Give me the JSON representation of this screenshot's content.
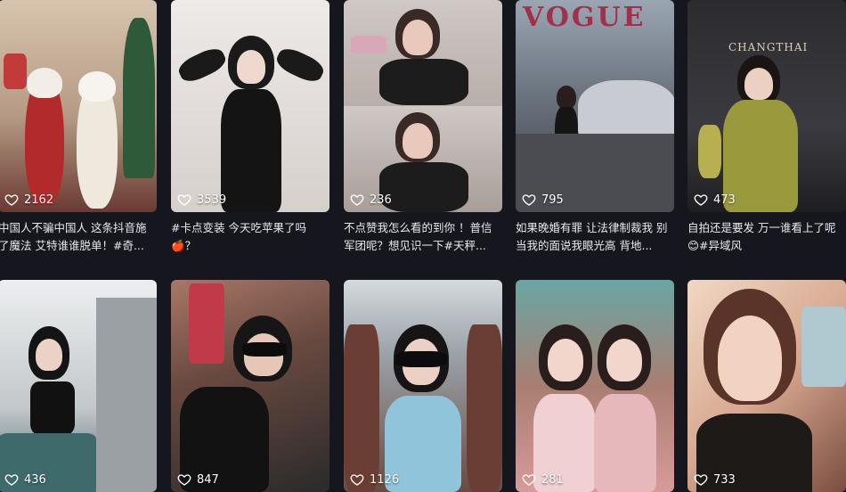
{
  "accent": "#ffffff",
  "background": "#16161e",
  "cards": [
    {
      "likes": "2162",
      "caption": "中国人不骗中国人 这条抖音施了魔法 艾特谁谁脱单！#奇...",
      "bg": [
        "#c9b29a",
        "#7a4a3a"
      ],
      "icon": "heart-icon"
    },
    {
      "likes": "3539",
      "caption": "#卡点变装 今天吃苹果了吗🍎？",
      "bg": [
        "#e8e4e2",
        "#b8b0aa"
      ],
      "icon": "heart-icon"
    },
    {
      "likes": "236",
      "caption": "不点赞我怎么看的到你 ！普信军团呢？想见识一下#天秤...",
      "bg": [
        "#c8c0bc",
        "#8a7f7c"
      ],
      "icon": "heart-icon"
    },
    {
      "likes": "795",
      "caption": "如果晚婚有罪 让法律制裁我 别当我的面说我眼光高 背地...",
      "bg": [
        "#6e7682",
        "#3a3e46"
      ],
      "icon": "heart-icon",
      "overlay_text": "VOGUE"
    },
    {
      "likes": "473",
      "caption": "自拍还是要发 万一谁看上了呢😊#异域风",
      "bg": [
        "#3c3c40",
        "#1e1e22"
      ],
      "icon": "heart-icon",
      "overlay_text": "CHANGTHAI"
    },
    {
      "likes": "436",
      "caption": "",
      "bg": [
        "#e6e8ea",
        "#8a9298"
      ],
      "icon": "heart-icon"
    },
    {
      "likes": "847",
      "caption": "",
      "bg": [
        "#8a6a5a",
        "#2a2a2a"
      ],
      "icon": "heart-icon"
    },
    {
      "likes": "1126",
      "caption": "",
      "bg": [
        "#c0c6cc",
        "#6a4a40"
      ],
      "icon": "heart-icon"
    },
    {
      "likes": "281",
      "caption": "",
      "bg": [
        "#6a9a9a",
        "#c05a5a"
      ],
      "icon": "heart-icon"
    },
    {
      "likes": "733",
      "caption": "",
      "bg": [
        "#e8c8b0",
        "#8a5a48"
      ],
      "icon": "heart-icon"
    }
  ]
}
